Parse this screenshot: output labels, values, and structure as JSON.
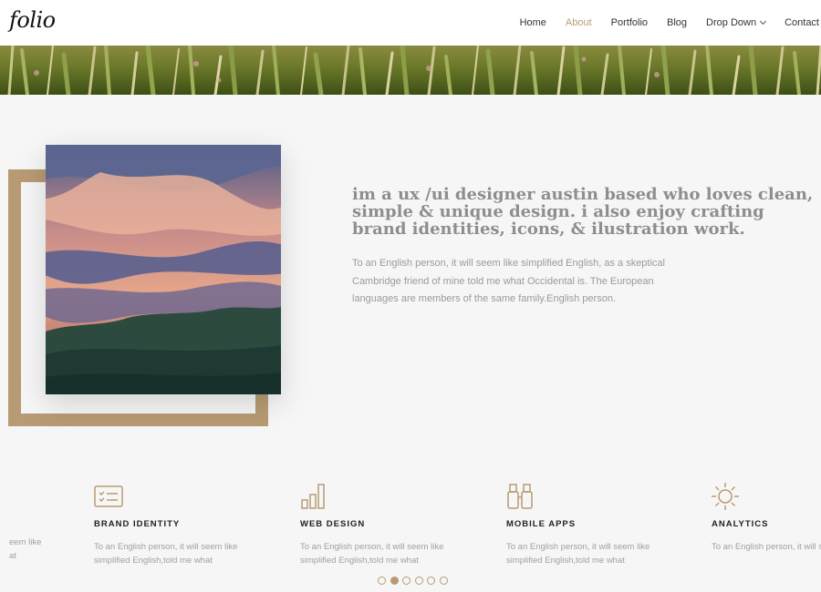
{
  "brand": {
    "logo": "folio"
  },
  "nav": {
    "items": [
      "Home",
      "About",
      "Portfolio",
      "Blog",
      "Drop Down",
      "Contact"
    ],
    "active": "About"
  },
  "intro": {
    "heading": "im a ux /ui designer austin based who loves clean, simple & unique design. i also enjoy crafting brand identities, icons, & ilustration work.",
    "body": "To an English person, it will seem like simplified English, as a skeptical Cambridge friend of mine told me what Occidental is. The European languages are members of the same family.English person."
  },
  "services": {
    "partial_left": [
      "eem like",
      "at"
    ],
    "items": [
      {
        "title": "BRAND IDENTITY",
        "desc": "To an English person, it will seem like simplified English,told me what",
        "icon": "id-card-icon"
      },
      {
        "title": "WEB DESIGN",
        "desc": "To an English person, it will seem like simplified English,told me what",
        "icon": "bar-chart-icon"
      },
      {
        "title": "MOBILE APPS",
        "desc": "To an English person, it will seem like simplified English,told me what",
        "icon": "binoculars-icon"
      },
      {
        "title": "ANALYTICS",
        "desc": "To an English person, it will seem like simplified English,told me what",
        "icon": "sun-icon"
      }
    ]
  },
  "carousel": {
    "count": 6,
    "active_index": 1
  },
  "colors": {
    "accent": "#b89b74",
    "background": "#f6f6f6",
    "header": "#ffffff"
  }
}
